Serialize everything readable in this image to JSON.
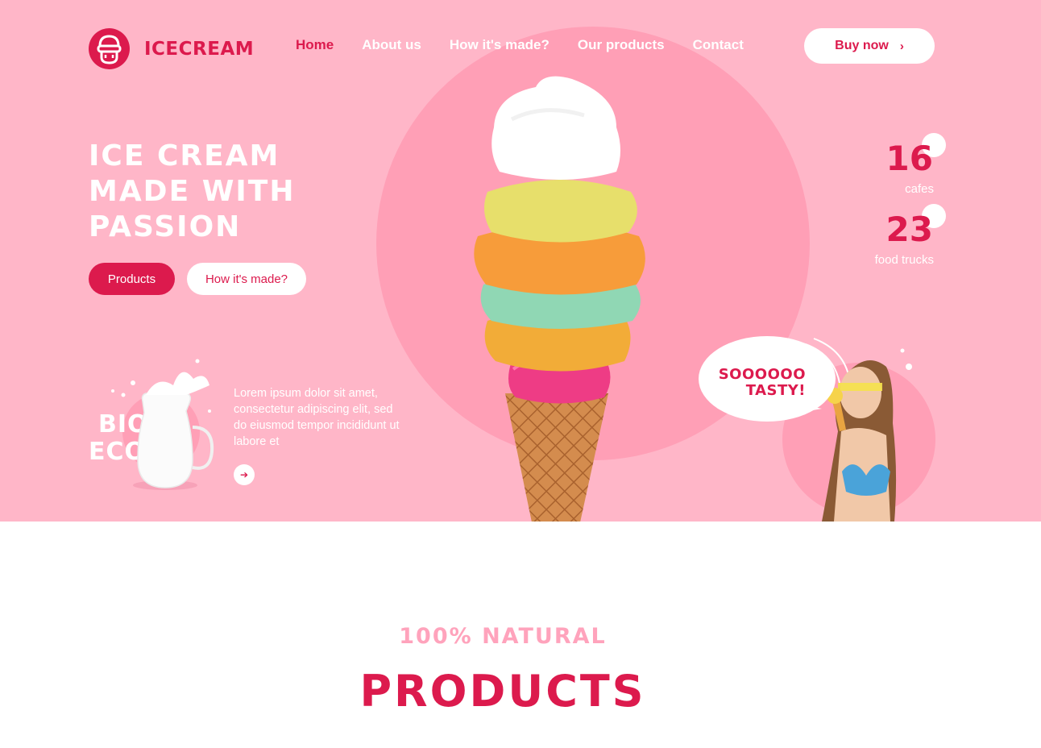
{
  "brand": {
    "name": "ICECREAM",
    "logo_icon": "ice-cream-face-icon"
  },
  "nav": {
    "items": [
      {
        "label": "Home",
        "active": true
      },
      {
        "label": "About us",
        "active": false
      },
      {
        "label": "How it's made?",
        "active": false
      },
      {
        "label": "Our products",
        "active": false
      },
      {
        "label": "Contact",
        "active": false
      }
    ],
    "buy_label": "Buy now",
    "buy_icon": "chevron-right-icon"
  },
  "hero": {
    "headline": [
      "ICE CREAM",
      "MADE WITH",
      "PASSION"
    ],
    "primary_button": "Products",
    "secondary_button": "How it's made?"
  },
  "feature": {
    "badge_lines": [
      "BIO",
      "ECO"
    ],
    "description": "Lorem ipsum dolor sit amet, consectetur adipiscing elit, sed do eiusmod tempor incididunt ut labore et",
    "arrow_icon": "arrow-right-icon"
  },
  "stats": [
    {
      "value": "16",
      "label": "cafes"
    },
    {
      "value": "23",
      "label": "food trucks"
    }
  ],
  "promo": {
    "bubble_lines": [
      "SOOOOOO",
      "TASTY!"
    ]
  },
  "section": {
    "eyebrow": "100% NATURAL",
    "title": "PRODUCTS"
  },
  "colors": {
    "hero_bg": "#ffb6c8",
    "accent": "#dc1a4d",
    "circle": "#ff9fb6",
    "eyebrow": "#ffa3bc"
  }
}
